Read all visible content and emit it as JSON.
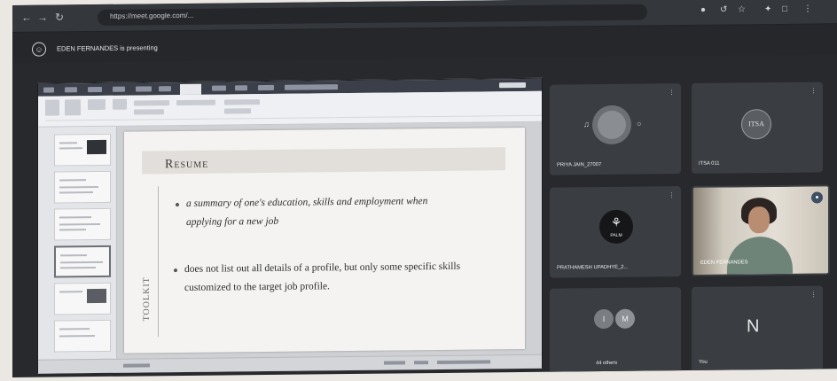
{
  "browser": {
    "url": "https://meet.google.com/...",
    "back_icon": "arrow-left-icon",
    "forward_icon": "arrow-right-icon",
    "reload_icon": "reload-icon"
  },
  "meet": {
    "presenting_banner": "EDEN FERNANDES is presenting",
    "presenter_avatar_icon": "person-icon"
  },
  "slide": {
    "title": "Resume",
    "vertical_word": "TOOLKIT",
    "bullets": [
      "a summary of one's education, skills and employment when applying for a new job",
      "does not list out all details of a profile, but only some specific skills customized to the target job profile."
    ]
  },
  "participants": [
    {
      "name": "PRIYA JAIN_27007",
      "muted": true
    },
    {
      "name": "ITSA 011",
      "avatar_text": "ITSA",
      "muted": true
    },
    {
      "name": "PRATHAMESH UPADHYE_2...",
      "avatar_text": "PALM",
      "muted": true
    },
    {
      "name": "EDEN FERNANDES",
      "speaking": true
    },
    {
      "name": "44 others",
      "avatars": [
        "I",
        "M"
      ]
    },
    {
      "name": "You",
      "avatar_letter": "N",
      "muted": true
    }
  ],
  "colors": {
    "meet_background": "#27292c",
    "tile_background": "#3a3d41",
    "slide_background": "#f4f3f1"
  }
}
